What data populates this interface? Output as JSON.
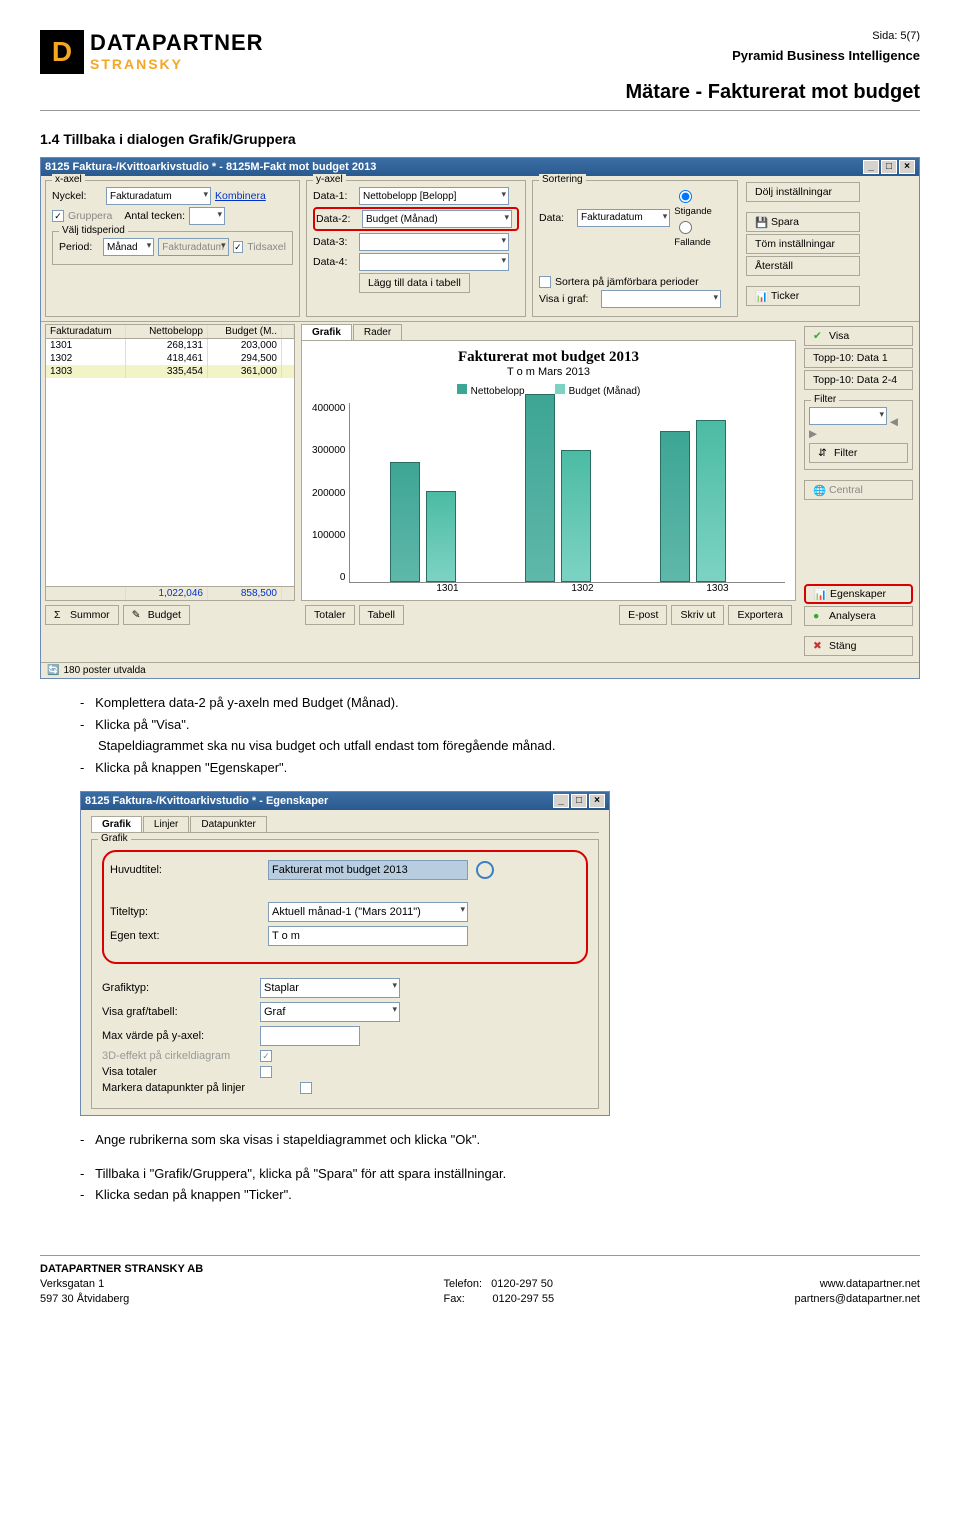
{
  "header": {
    "page_num": "Sida: 5(7)",
    "pbi": "Pyramid Business Intelligence",
    "title": "Mätare - Fakturerat mot budget",
    "brand_top": "DATAPARTNER",
    "brand_sub": "STRANSKY"
  },
  "section_title": "1.4   Tillbaka i dialogen Grafik/Gruppera",
  "win1": {
    "title": "8125 Faktura-/Kvittoarkivstudio * - 8125M-Fakt mot budget 2013",
    "xaxis_legend": "x-axel",
    "yaxis_legend": "y-axel",
    "sort_legend": "Sortering",
    "nyckel_lbl": "Nyckel:",
    "nyckel_val": "Fakturadatum",
    "kombinera": "Kombinera",
    "gruppera_lbl": "Gruppera",
    "antal_lbl": "Antal tecken:",
    "valj_tids": "Välj tidsperiod",
    "period_lbl": "Period:",
    "period_val": "Månad",
    "fakturadatum_sel": "Fakturadatum",
    "tidsaxel": "Tidsaxel",
    "data1_lbl": "Data-1:",
    "data1_val": "Nettobelopp [Belopp]",
    "data2_lbl": "Data-2:",
    "data2_val": "Budget (Månad)",
    "data3_lbl": "Data-3:",
    "data4_lbl": "Data-4:",
    "lagg_btn": "Lägg till data i tabell",
    "sort_data_lbl": "Data:",
    "sort_data_val": "Fakturadatum",
    "stigande": "Stigande",
    "fallande": "Fallande",
    "sortera_jam": "Sortera på jämförbara perioder",
    "visa_graf_lbl": "Visa i graf:",
    "side": {
      "dolj": "Dölj inställningar",
      "spara": "Spara",
      "tom": "Töm inställningar",
      "aterstall": "Återställ",
      "ticker": "Ticker",
      "visa": "Visa",
      "topp1": "Topp-10: Data 1",
      "topp24": "Topp-10: Data 2-4",
      "filter_legend": "Filter",
      "filter_btn": "Filter",
      "central": "Central",
      "egenskaper": "Egenskaper",
      "analysera": "Analysera",
      "stang": "Stäng"
    },
    "table": {
      "h1": "Fakturadatum",
      "h2": "Nettobelopp",
      "h3": "Budget (M..",
      "rows": [
        {
          "c1": "1301",
          "c2": "268,131",
          "c3": "203,000"
        },
        {
          "c1": "1302",
          "c2": "418,461",
          "c3": "294,500"
        },
        {
          "c1": "1303",
          "c2": "335,454",
          "c3": "361,000"
        }
      ],
      "tot2": "1,022,046",
      "tot3": "858,500",
      "summor": "Summor",
      "budget": "Budget"
    },
    "tabs": {
      "grafik": "Grafik",
      "rader": "Rader"
    },
    "chart": {
      "title": "Fakturerat mot budget 2013",
      "sub": "T o m Mars 2013",
      "leg1": "Nettobelopp",
      "leg2": "Budget (Månad)",
      "y4": "400000",
      "y3": "300000",
      "y2": "200000",
      "y1": "100000",
      "y0": "0",
      "x1": "1301",
      "x2": "1302",
      "x3": "1303"
    },
    "bottom_btns": {
      "totaler": "Totaler",
      "tabell": "Tabell",
      "epost": "E-post",
      "skrivut": "Skriv ut",
      "exportera": "Exportera"
    },
    "status": "180 poster utvalda"
  },
  "instr1": [
    "Komplettera data-2 på y-axeln med Budget (Månad).",
    "Klicka på \"Visa\".",
    "Stapeldiagrammet ska nu visa budget och utfall endast tom föregående månad.",
    "Klicka på knappen \"Egenskaper\"."
  ],
  "win2": {
    "title": "8125 Faktura-/Kvittoarkivstudio * - Egenskaper",
    "tabs": {
      "grafik": "Grafik",
      "linjer": "Linjer",
      "data": "Datapunkter"
    },
    "grp": "Grafik",
    "huvud_lbl": "Huvudtitel:",
    "huvud_val": "Fakturerat mot budget 2013",
    "titeltyp_lbl": "Titeltyp:",
    "titeltyp_val": "Aktuell månad-1 (\"Mars 2011\")",
    "egen_lbl": "Egen text:",
    "egen_val": "T o m",
    "grafiktyp_lbl": "Grafiktyp:",
    "grafiktyp_val": "Staplar",
    "visagraf_lbl": "Visa graf/tabell:",
    "visagraf_val": "Graf",
    "maxy_lbl": "Max värde på y-axel:",
    "threeD_lbl": "3D-effekt på cirkeldiagram",
    "visatot_lbl": "Visa totaler",
    "markera_lbl": "Markera datapunkter på linjer"
  },
  "instr2": [
    "Ange rubrikerna som ska visas i stapeldiagrammet och klicka \"Ok\".",
    "Tillbaka i \"Grafik/Gruppera\", klicka på \"Spara\" för att spara inställningar.",
    "Klicka sedan på knappen \"Ticker\"."
  ],
  "footer": {
    "company": "DATAPARTNER STRANSKY AB",
    "addr1": "Verksgatan 1",
    "addr2": "597 30 Åtvidaberg",
    "tel_lbl": "Telefon:",
    "tel": "0120-297 50",
    "fax_lbl": "Fax:",
    "fax": "0120-297 55",
    "www": "www.datapartner.net",
    "mail": "partners@datapartner.net"
  },
  "chart_data": {
    "type": "bar",
    "title": "Fakturerat mot budget 2013",
    "subtitle": "T o m Mars 2013",
    "categories": [
      "1301",
      "1302",
      "1303"
    ],
    "series": [
      {
        "name": "Nettobelopp",
        "values": [
          268131,
          418461,
          335454
        ]
      },
      {
        "name": "Budget (Månad)",
        "values": [
          203000,
          294500,
          361000
        ]
      }
    ],
    "ylim": [
      0,
      400000
    ],
    "ylabel": "",
    "xlabel": ""
  }
}
